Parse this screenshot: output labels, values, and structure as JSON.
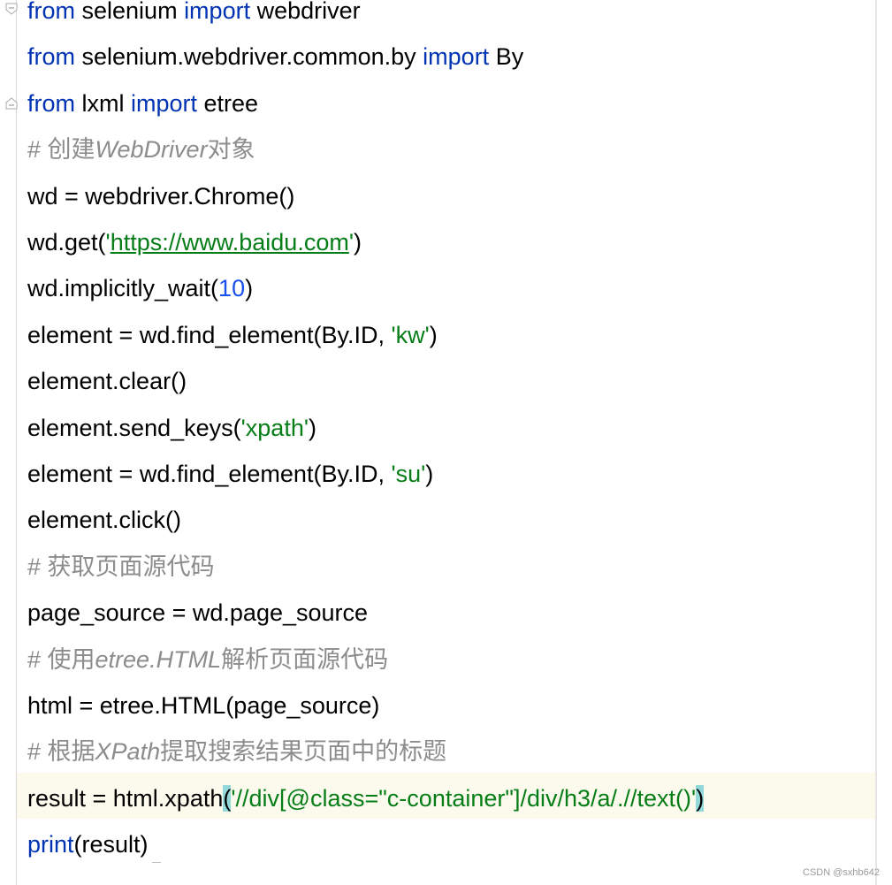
{
  "editor": {
    "lines": [
      {
        "parts": [
          {
            "t": "from",
            "c": "kw"
          },
          {
            "t": " selenium "
          },
          {
            "t": "import",
            "c": "kw"
          },
          {
            "t": " webdriver"
          }
        ]
      },
      {
        "parts": [
          {
            "t": "from",
            "c": "kw"
          },
          {
            "t": " selenium.webdriver.common.by "
          },
          {
            "t": "import",
            "c": "kw"
          },
          {
            "t": " By"
          }
        ]
      },
      {
        "parts": [
          {
            "t": "from",
            "c": "kw"
          },
          {
            "t": " lxml "
          },
          {
            "t": "import",
            "c": "kw"
          },
          {
            "t": " etree"
          }
        ]
      },
      {
        "parts": [
          {
            "t": "# 创建",
            "c": "cm"
          },
          {
            "t": "WebDriver",
            "c": "cm cm-i"
          },
          {
            "t": "对象",
            "c": "cm"
          }
        ]
      },
      {
        "parts": [
          {
            "t": "wd = webdriver.Chrome()"
          }
        ]
      },
      {
        "parts": [
          {
            "t": "wd.get("
          },
          {
            "t": "'",
            "c": "str"
          },
          {
            "t": "https://www.baidu.com",
            "c": "str url"
          },
          {
            "t": "'",
            "c": "str"
          },
          {
            "t": ")"
          }
        ]
      },
      {
        "parts": [
          {
            "t": "wd.implicitly_wait("
          },
          {
            "t": "10",
            "c": "num"
          },
          {
            "t": ")"
          }
        ]
      },
      {
        "parts": [
          {
            "t": "element = wd.find_element(By.ID, "
          },
          {
            "t": "'kw'",
            "c": "str"
          },
          {
            "t": ")"
          }
        ]
      },
      {
        "parts": [
          {
            "t": "element.clear()"
          }
        ]
      },
      {
        "parts": [
          {
            "t": "element.send_keys("
          },
          {
            "t": "'xpath'",
            "c": "str"
          },
          {
            "t": ")"
          }
        ]
      },
      {
        "parts": [
          {
            "t": "element = wd.find_element(By.ID, "
          },
          {
            "t": "'su'",
            "c": "str"
          },
          {
            "t": ")"
          }
        ]
      },
      {
        "parts": [
          {
            "t": "element.click()"
          }
        ]
      },
      {
        "parts": [
          {
            "t": "# 获取页面源代码",
            "c": "cm"
          }
        ]
      },
      {
        "parts": [
          {
            "t": "page_source = wd.page_source"
          }
        ]
      },
      {
        "parts": [
          {
            "t": "# 使用",
            "c": "cm"
          },
          {
            "t": "etree.HTML",
            "c": "cm cm-i"
          },
          {
            "t": "解析页面源代码",
            "c": "cm"
          }
        ]
      },
      {
        "parts": [
          {
            "t": "html = etree.HTML(page_source)"
          }
        ]
      },
      {
        "parts": [
          {
            "t": "# 根据",
            "c": "cm"
          },
          {
            "t": "XPath",
            "c": "cm cm-i"
          },
          {
            "t": "提取搜索结果页面中的标题",
            "c": "cm"
          }
        ]
      },
      {
        "parts": [
          {
            "t": "result = html.xpath"
          },
          {
            "t": "(",
            "c": "brace-hl"
          },
          {
            "t": "'//div[@class=\"c-container\"]/div/h3/a/.//text()'",
            "c": "str"
          },
          {
            "t": ")",
            "c": "brace-hl"
          }
        ]
      },
      {
        "parts": [
          {
            "t": "print",
            "c": "kw"
          },
          {
            "t": "(result)"
          }
        ]
      }
    ]
  },
  "watermark": "CSDN @sxhb642",
  "colors": {
    "keyword": "#0033b3",
    "number": "#1750eb",
    "string": "#067d17",
    "comment": "#8c8c8c",
    "current_line": "#fcfaed",
    "brace_highlight": "#93d9d9"
  }
}
